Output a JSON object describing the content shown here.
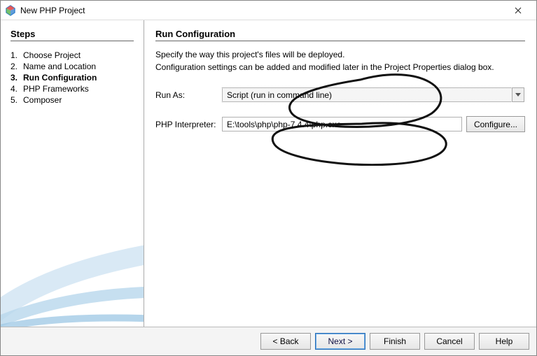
{
  "window": {
    "title": "New PHP Project"
  },
  "sidebar": {
    "heading": "Steps",
    "steps": [
      {
        "num": "1.",
        "label": "Choose Project"
      },
      {
        "num": "2.",
        "label": "Name and Location"
      },
      {
        "num": "3.",
        "label": "Run Configuration"
      },
      {
        "num": "4.",
        "label": "PHP Frameworks"
      },
      {
        "num": "5.",
        "label": "Composer"
      }
    ],
    "currentIndex": 2
  },
  "main": {
    "heading": "Run Configuration",
    "desc1": "Specify the way this project's files will be deployed.",
    "desc2": "Configuration settings can be added and modified later in the Project Properties dialog box.",
    "runAsLabel": "Run As:",
    "runAsValue": "Script (run in command line)",
    "interpLabel": "PHP Interpreter:",
    "interpValue": "E:\\tools\\php\\php-7.4.4\\php.exe",
    "configureBtn": "Configure..."
  },
  "footer": {
    "back": "< Back",
    "next": "Next >",
    "finish": "Finish",
    "cancel": "Cancel",
    "help": "Help"
  }
}
